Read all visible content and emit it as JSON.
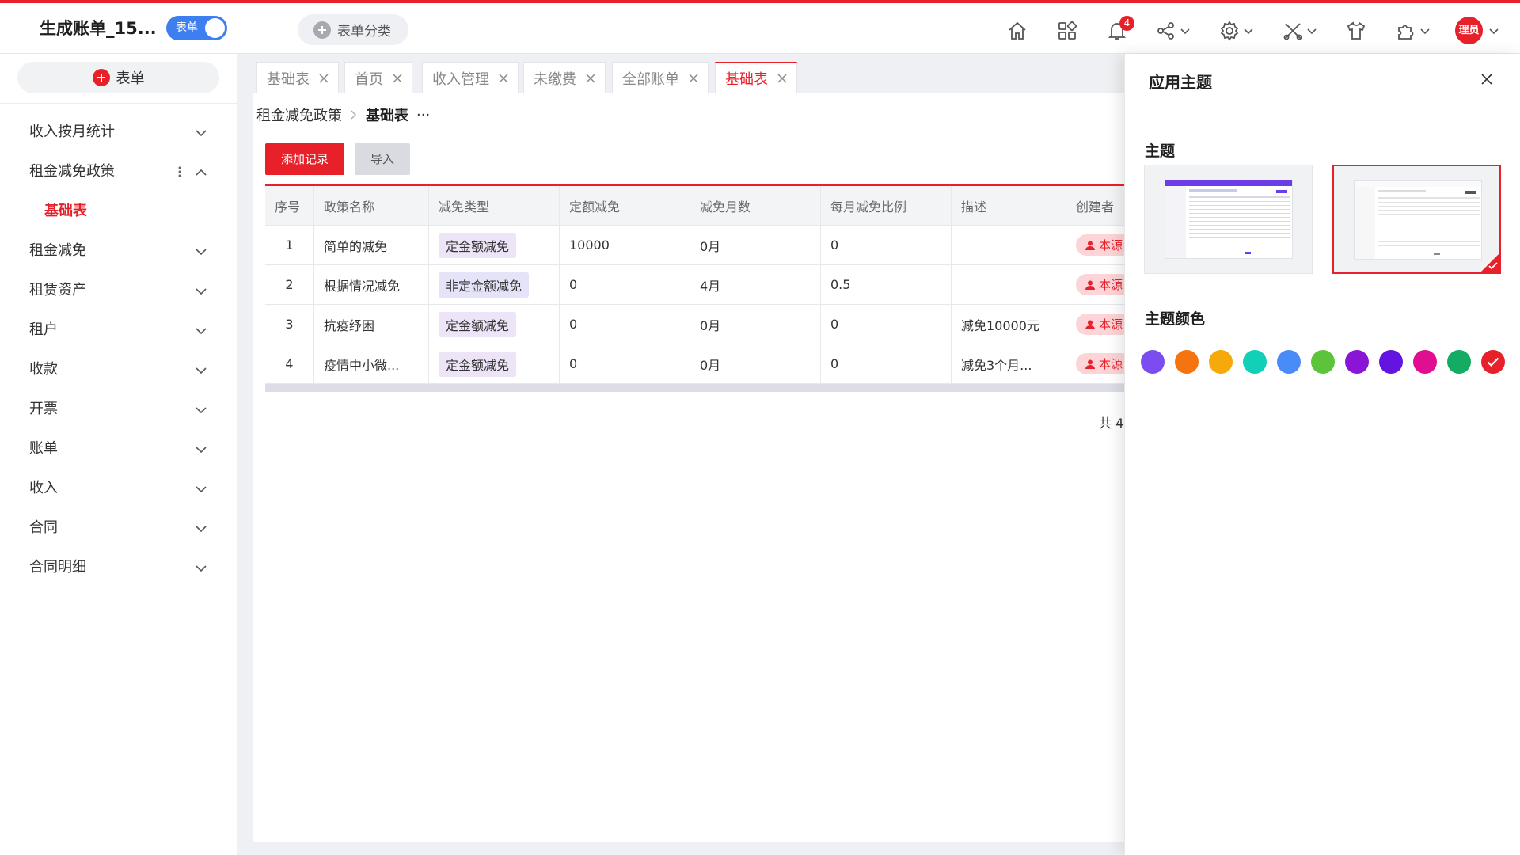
{
  "header": {
    "app_title": "生成账单_15...",
    "mode_label": "表单",
    "category_label": "表单分类",
    "notification_count": "4",
    "avatar_text": "理员"
  },
  "sidebar": {
    "add_label": "表单",
    "items": [
      {
        "label": "收入按月统计"
      },
      {
        "label": "租金减免政策"
      },
      {
        "label": "基础表"
      },
      {
        "label": "租金减免"
      },
      {
        "label": "租赁资产"
      },
      {
        "label": "租户"
      },
      {
        "label": "收款"
      },
      {
        "label": "开票"
      },
      {
        "label": "账单"
      },
      {
        "label": "收入"
      },
      {
        "label": "合同"
      },
      {
        "label": "合同明细"
      }
    ]
  },
  "tabs": [
    {
      "label": "基础表"
    },
    {
      "label": "首页"
    },
    {
      "label": "收入管理"
    },
    {
      "label": "未缴费"
    },
    {
      "label": "全部账单"
    },
    {
      "label": "基础表",
      "active": true
    }
  ],
  "breadcrumb": {
    "parent": "租金减免政策",
    "current": "基础表",
    "more": "···"
  },
  "toolbar": {
    "add_label": "添加记录",
    "import_label": "导入"
  },
  "table": {
    "headers": [
      "序号",
      "政策名称",
      "减免类型",
      "定额减免",
      "减免月数",
      "每月减免比例",
      "描述",
      "创建者"
    ],
    "rows": [
      {
        "no": "1",
        "name": "简单的减免",
        "type": "定金额减免",
        "fixed": "10000",
        "months": "0月",
        "ratio": "0",
        "desc": "",
        "creator": "本源"
      },
      {
        "no": "2",
        "name": "根据情况减免",
        "type": "非定金额减免",
        "fixed": "0",
        "months": "4月",
        "ratio": "0.5",
        "desc": "",
        "creator": "本源"
      },
      {
        "no": "3",
        "name": "抗疫纾困",
        "type": "定金额减免",
        "fixed": "0",
        "months": "0月",
        "ratio": "0",
        "desc": "减免10000元",
        "creator": "本源"
      },
      {
        "no": "4",
        "name": "疫情中小微...",
        "type": "定金额减免",
        "fixed": "0",
        "months": "0月",
        "ratio": "0",
        "desc": "减免3个月...",
        "creator": "本源"
      }
    ],
    "total": "共 4"
  },
  "theme_panel": {
    "title": "应用主题",
    "theme_label": "主题",
    "color_label": "主题颜色",
    "themes": [
      {
        "id": "purple-header"
      },
      {
        "id": "light-red",
        "selected": true
      }
    ],
    "colors": [
      "#7b4df0",
      "#f6740f",
      "#f5a90a",
      "#12cfb8",
      "#4a8cf7",
      "#5cc43a",
      "#8b15d6",
      "#6314e0",
      "#e00e90",
      "#13ac62",
      "#e8202a"
    ],
    "selected_color": "#e8202a"
  }
}
